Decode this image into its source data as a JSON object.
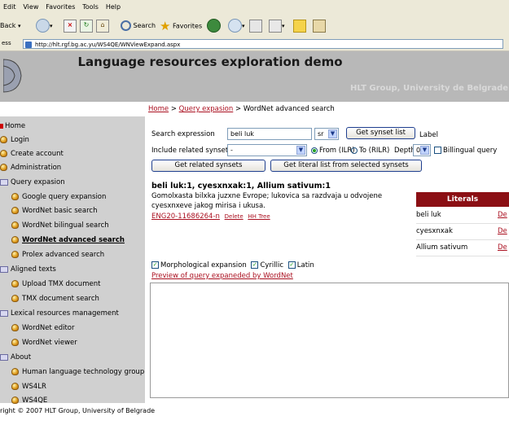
{
  "browser": {
    "menu": [
      "Edit",
      "View",
      "Favorites",
      "Tools",
      "Help"
    ],
    "toolbar": {
      "back": "Back",
      "search": "Search",
      "favorites": "Favorites"
    },
    "address_label": "ess",
    "url": "http://hlt.rgf.bg.ac.yu/WS4QE/WNViewExpand.aspx"
  },
  "header": {
    "title": "Language resources exploration demo",
    "subtitle": "HLT Group, University de Belgrade"
  },
  "breadcrumb": {
    "home": "Home",
    "sep1": ">",
    "query": "Query expasion",
    "sep2": ">",
    "current": "WordNet advanced search"
  },
  "sidebar": {
    "home": "Home",
    "login": "Login",
    "create_account": "Create account",
    "administration": "Administration",
    "query_expasion": "Query expasion",
    "google_query": "Google query expansion",
    "wn_basic": "WordNet basic search",
    "wn_bilingual": "WordNet bilingual search",
    "wn_advanced": "WordNet advanced search",
    "prolex": "Prolex advanced search",
    "aligned_texts": "Aligned texts",
    "upload_tmx": "Upload TMX document",
    "tmx_search": "TMX document search",
    "lexical": "Lexical resources management",
    "wn_editor": "WordNet editor",
    "wn_viewer": "WordNet viewer",
    "about": "About",
    "hlt_group": "Human language technology group",
    "ws4lr": "WS4LR",
    "ws4qe": "WS4QE"
  },
  "form": {
    "search_expression_label": "Search expression",
    "search_value": "beli luk",
    "lang_value": "sr",
    "get_synset_list": "Get synset list",
    "label_text": "Label",
    "include_related_label": "Include related synsets",
    "include_related_value": "-",
    "from_label": "From (ILR)",
    "to_label": "To (RILR)",
    "depth_label": "Depth",
    "depth_value": "0",
    "bilingual_label": "Billingual query",
    "get_related": "Get related synsets",
    "get_literal_list": "Get literal list from selected synsets"
  },
  "result": {
    "title": "beli luk:1, cyesxnxak:1, Allium sativum:1",
    "gloss1": "Gomolxasta bilxka juzxne Evrope; lukovica sa razdvaja u odvojene",
    "gloss2": "cyesxnxeve jakog mirisa i ukusa.",
    "id_link": "ENG20-11686264-n",
    "delete_link": "Delete",
    "tree_link": "HH Tree"
  },
  "literals": {
    "header": "Literals",
    "rows": [
      {
        "name": "beli luk",
        "action": "De"
      },
      {
        "name": "cyesxnxak",
        "action": "De"
      },
      {
        "name": "Allium sativum",
        "action": "De"
      }
    ]
  },
  "options": {
    "morph": "Morphological expansion",
    "cyrillic": "Cyrillic",
    "latin": "Latin",
    "preview_link": "Preview of query expaneded by WordNet"
  },
  "footer": "right © 2007 HLT Group, University of Belgrade"
}
